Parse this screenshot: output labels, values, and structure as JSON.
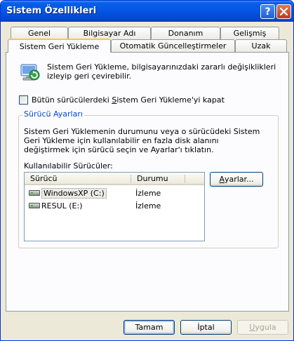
{
  "window": {
    "title": "Sistem Özellikleri"
  },
  "titlebar": {
    "help_glyph": "?",
    "close_glyph": "✕"
  },
  "tabs": {
    "row1": [
      {
        "label": "Genel"
      },
      {
        "label": "Bilgisayar Adı"
      },
      {
        "label": "Donanım"
      },
      {
        "label": "Gelişmiş"
      }
    ],
    "row2": [
      {
        "label": "Sistem Geri Yükleme",
        "active": true
      },
      {
        "label": "Otomatik Güncelleştirmeler"
      },
      {
        "label": "Uzak"
      }
    ]
  },
  "panel": {
    "icon": "system-restore-icon",
    "intro": "Sistem Geri Yükleme, bilgisayarınızdaki zararlı değişiklikleri izleyip geri çevirebilir.",
    "turn_off_checkbox": {
      "checked": false,
      "label_pre": "Bütün sürücülerdeki ",
      "label_mnemonic": "S",
      "label_post": "istem Geri Yükleme'yi kapat"
    },
    "drive_settings": {
      "legend": "Sürücü Ayarları",
      "description": "Sistem Geri Yüklemenin durumunu veya o sürücüdeki Sistem Geri Yükleme için kullanılabilir en fazla disk alanını değiştirmek için sürücü seçin ve Ayarlar'ı tıklatın.",
      "list_label": "Kullanılabilir Sürücüler:",
      "columns": [
        "Sürücü",
        "Durumu"
      ],
      "drives": [
        {
          "name": "WindowsXP (C:)",
          "status": "İzleme",
          "icon": "hard-drive-icon",
          "selected": true
        },
        {
          "name": "RESUL (E:)",
          "status": "İzleme",
          "icon": "hard-drive-icon",
          "selected": false
        }
      ],
      "settings_button": {
        "mnemonic": "A",
        "rest": "yarlar..."
      }
    }
  },
  "footer": {
    "ok": "Tamam",
    "cancel": "İptal",
    "apply_mnemonic": "U",
    "apply_rest": "ygula",
    "apply_enabled": false
  },
  "colors": {
    "titlebar": "#0455e4",
    "window_bg": "#ece9d8",
    "panel_bg": "#fcfcfe",
    "active_tab_accent": "#ffc83c",
    "group_legend": "#0046d5"
  }
}
